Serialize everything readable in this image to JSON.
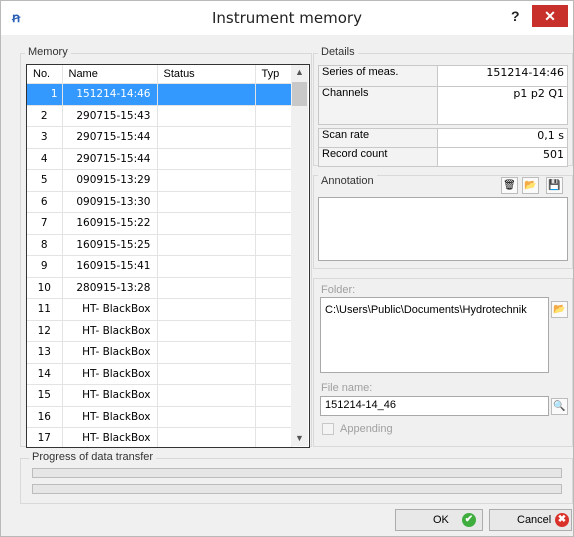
{
  "window": {
    "title": "Instrument memory",
    "app_icon": "ꞥ",
    "help_label": "?",
    "close_label": "✕"
  },
  "memory": {
    "group_label": "Memory",
    "columns": [
      "No.",
      "Name",
      "Status",
      "Typ"
    ],
    "rows": [
      {
        "no": "1",
        "name": "151214-14:46",
        "status": "",
        "typ": ""
      },
      {
        "no": "2",
        "name": "290715-15:43",
        "status": "",
        "typ": ""
      },
      {
        "no": "3",
        "name": "290715-15:44",
        "status": "",
        "typ": ""
      },
      {
        "no": "4",
        "name": "290715-15:44",
        "status": "",
        "typ": ""
      },
      {
        "no": "5",
        "name": "090915-13:29",
        "status": "",
        "typ": ""
      },
      {
        "no": "6",
        "name": "090915-13:30",
        "status": "",
        "typ": ""
      },
      {
        "no": "7",
        "name": "160915-15:22",
        "status": "",
        "typ": ""
      },
      {
        "no": "8",
        "name": "160915-15:25",
        "status": "",
        "typ": ""
      },
      {
        "no": "9",
        "name": "160915-15:41",
        "status": "",
        "typ": ""
      },
      {
        "no": "10",
        "name": "280915-13:28",
        "status": "",
        "typ": ""
      },
      {
        "no": "11",
        "name": "HT- BlackBox",
        "status": "",
        "typ": ""
      },
      {
        "no": "12",
        "name": "HT- BlackBox",
        "status": "",
        "typ": ""
      },
      {
        "no": "13",
        "name": "HT- BlackBox",
        "status": "",
        "typ": ""
      },
      {
        "no": "14",
        "name": "HT- BlackBox",
        "status": "",
        "typ": ""
      },
      {
        "no": "15",
        "name": "HT- BlackBox",
        "status": "",
        "typ": ""
      },
      {
        "no": "16",
        "name": "HT- BlackBox",
        "status": "",
        "typ": ""
      },
      {
        "no": "17",
        "name": "HT- BlackBox",
        "status": "",
        "typ": ""
      }
    ],
    "selected_index": 0,
    "scroll_up": "▲",
    "scroll_down": "▼"
  },
  "details": {
    "group_label": "Details",
    "series_label": "Series of meas.",
    "series_value": "151214-14:46",
    "channels_label": "Channels",
    "channels_value": "p1 p2 Q1",
    "scan_rate_label": "Scan rate",
    "scan_rate_value": "0,1 s",
    "record_count_label": "Record count",
    "record_count_value": "501"
  },
  "annotation": {
    "group_label": "Annotation",
    "value": "",
    "delete_icon": "🗑",
    "open_icon": "📂",
    "save_icon": "💾"
  },
  "export": {
    "folder_label": "Folder:",
    "folder_value": "C:\\Users\\Public\\Documents\\Hydrotechnik",
    "folder_browse_icon": "📂",
    "file_name_label": "File name:",
    "file_name_value": "151214-14_46",
    "file_search_icon": "🔍",
    "appending_label": "Appending",
    "appending_checked": false
  },
  "progress": {
    "group_label": "Progress of data transfer",
    "bar1_fraction": 0,
    "bar2_fraction": 0
  },
  "buttons": {
    "ok_label": "OK",
    "ok_icon": "✔",
    "cancel_label": "Cancel",
    "cancel_icon": "✖"
  },
  "colors": {
    "selection": "#3399ff",
    "close_button": "#c8302c",
    "ok_icon": "#3fae3f",
    "cancel_icon": "#d9322a"
  }
}
